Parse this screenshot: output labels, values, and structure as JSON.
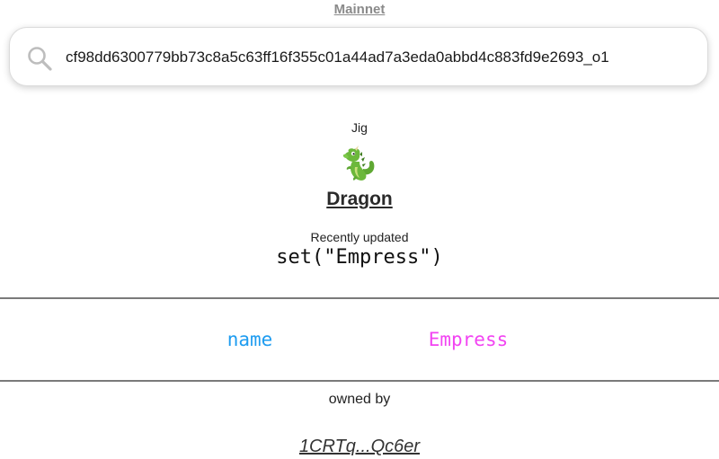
{
  "header": {
    "network_label": "Mainnet"
  },
  "search": {
    "value": "cf98dd6300779bb73c8a5c63ff16f355c01a44ad7a3eda0abbd4c883fd9e2693_o1",
    "icon": "search-icon"
  },
  "jig": {
    "kind_label": "Jig",
    "icon": "dragon-icon",
    "name": "Dragon",
    "updated_label": "Recently updated",
    "updated_call": "set(\"Empress\")"
  },
  "properties": [
    {
      "key": "name",
      "value": "Empress"
    }
  ],
  "owner": {
    "label": "owned by",
    "address": "1CRTq...Qc6er"
  },
  "colors": {
    "property_key": "#1e9cf0",
    "property_value": "#f244f2",
    "divider": "#7a7a7a",
    "network_link": "#8a8a8a"
  }
}
